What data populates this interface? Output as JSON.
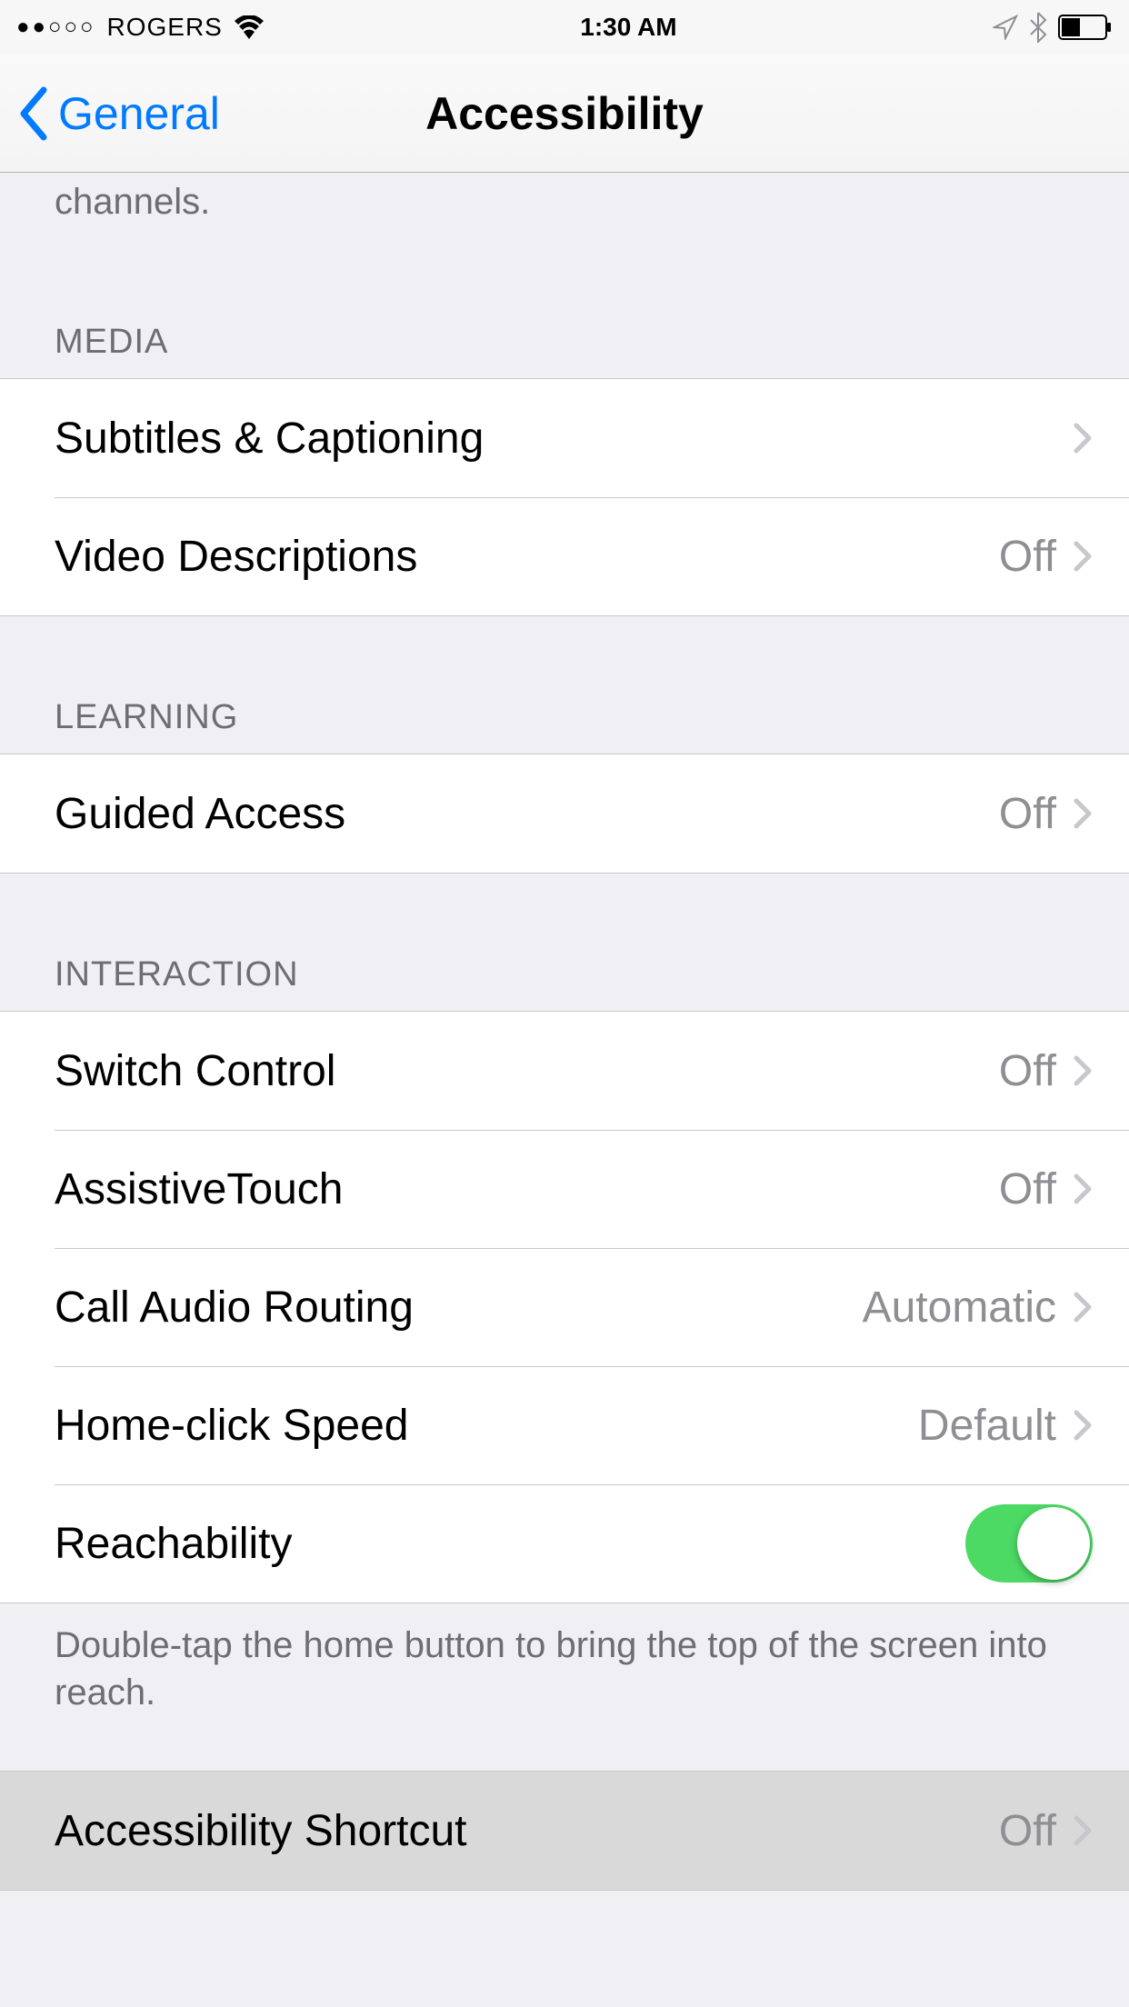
{
  "status": {
    "signal": "●●○○○",
    "carrier": "ROGERS",
    "time": "1:30 AM"
  },
  "nav": {
    "back_label": "General",
    "title": "Accessibility"
  },
  "partial_footer": "channels.",
  "sections": {
    "media": {
      "header": "MEDIA",
      "rows": [
        {
          "label": "Subtitles & Captioning",
          "value": ""
        },
        {
          "label": "Video Descriptions",
          "value": "Off"
        }
      ]
    },
    "learning": {
      "header": "LEARNING",
      "rows": [
        {
          "label": "Guided Access",
          "value": "Off"
        }
      ]
    },
    "interaction": {
      "header": "INTERACTION",
      "rows": [
        {
          "label": "Switch Control",
          "value": "Off"
        },
        {
          "label": "AssistiveTouch",
          "value": "Off"
        },
        {
          "label": "Call Audio Routing",
          "value": "Automatic"
        },
        {
          "label": "Home-click Speed",
          "value": "Default"
        },
        {
          "label": "Reachability",
          "toggle": true
        }
      ],
      "footer": "Double-tap the home button to bring the top of the screen into reach."
    },
    "shortcut": {
      "rows": [
        {
          "label": "Accessibility Shortcut",
          "value": "Off"
        }
      ]
    }
  }
}
